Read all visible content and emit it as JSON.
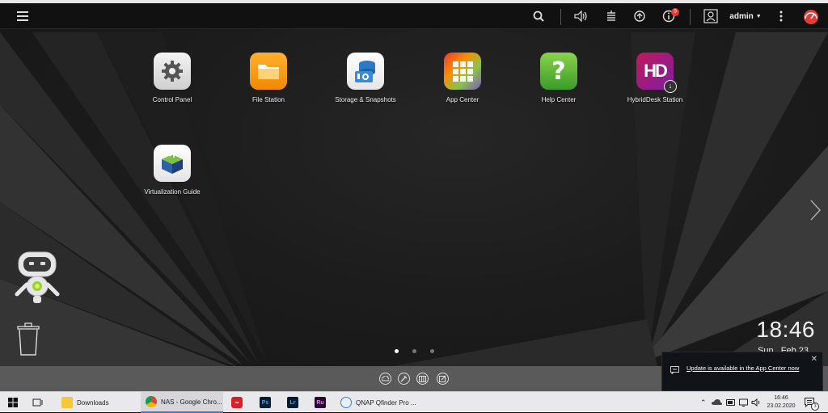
{
  "topbar": {
    "user": "admin",
    "notification_count": "9",
    "icons": [
      "menu-icon",
      "search-icon",
      "volume-icon",
      "stack-icon",
      "sync-icon",
      "info-icon",
      "user-icon",
      "more-icon",
      "dashboard-icon"
    ]
  },
  "apps": [
    {
      "label": "Control Panel",
      "icon": "gear-icon"
    },
    {
      "label": "File Station",
      "icon": "folder-icon"
    },
    {
      "label": "Storage & Snapshots",
      "icon": "storage-icon"
    },
    {
      "label": "App Center",
      "icon": "grid-icon"
    },
    {
      "label": "Help Center",
      "icon": "question-icon"
    },
    {
      "label": "HybridDesk Station",
      "icon": "hd-icon"
    },
    {
      "label": "Virtualization Guide",
      "icon": "cube-icon"
    }
  ],
  "clock": {
    "time": "18:46",
    "date": "Sun., Feb 23"
  },
  "pagination": {
    "current": 1,
    "total": 3
  },
  "notification": {
    "text": "Update is available in the App Center now"
  },
  "taskbar": {
    "items": [
      {
        "label": "Downloads"
      },
      {
        "label": "NAS - Google Chro..."
      },
      {
        "label": ""
      },
      {
        "label": "Ps"
      },
      {
        "label": "Lr"
      },
      {
        "label": "Ru"
      },
      {
        "label": "QNAP Qfinder Pro ..."
      }
    ],
    "time": "16:46",
    "date": "23.02.2020",
    "notif_count": "3"
  },
  "colors": {
    "accent": "#3a7bd5",
    "badge": "#e53935",
    "dock": "#5a5a5a"
  }
}
